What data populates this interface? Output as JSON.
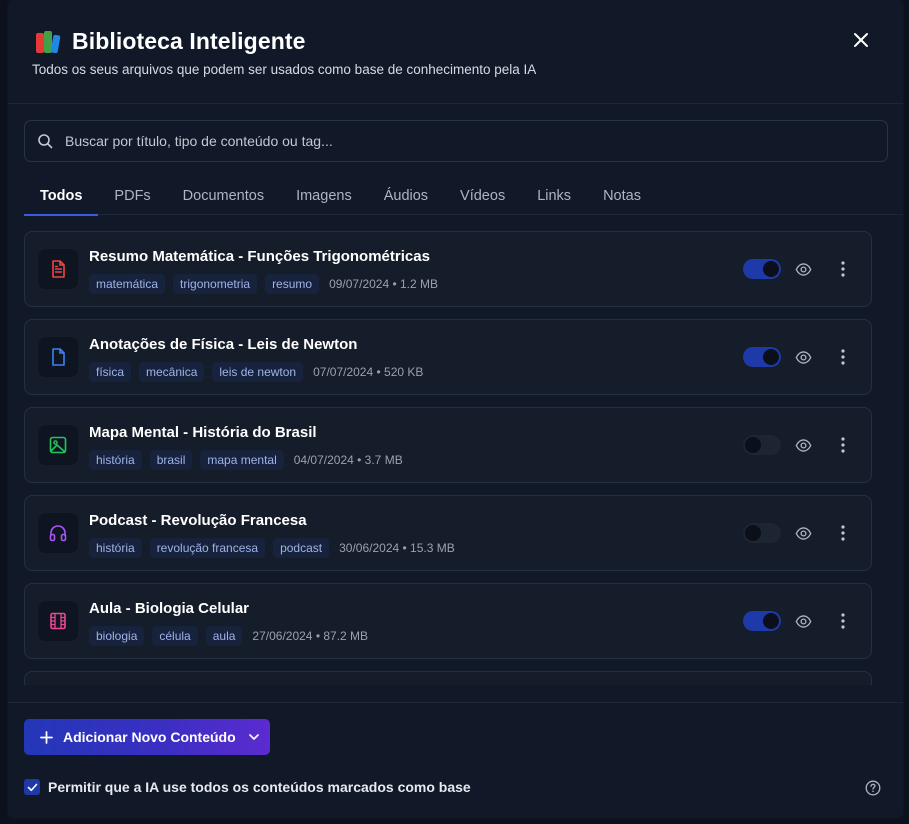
{
  "header": {
    "title": "Biblioteca Inteligente",
    "subtitle": "Todos os seus arquivos que podem ser usados como base de conhecimento pela IA",
    "close_symbol": "✕",
    "outer_close_symbol": "✕",
    "icon": "books-icon"
  },
  "search": {
    "placeholder": "Buscar por título, tipo de conteúdo ou tag...",
    "icon": "search-icon"
  },
  "tabs": [
    {
      "label": "Todos",
      "active": true
    },
    {
      "label": "PDFs",
      "active": false
    },
    {
      "label": "Documentos",
      "active": false
    },
    {
      "label": "Imagens",
      "active": false
    },
    {
      "label": "Áudios",
      "active": false
    },
    {
      "label": "Vídeos",
      "active": false
    },
    {
      "label": "Links",
      "active": false
    },
    {
      "label": "Notas",
      "active": false
    }
  ],
  "items": [
    {
      "title": "Resumo Matemática - Funções Trigonométricas",
      "tags": [
        "matemática",
        "trigonometria",
        "resumo"
      ],
      "meta": "09/07/2024 • 1.2 MB",
      "icon": "pdf-file-icon",
      "icon_color": "#ef4444",
      "enabled": true
    },
    {
      "title": "Anotações de Física - Leis de Newton",
      "tags": [
        "física",
        "mecânica",
        "leis de newton"
      ],
      "meta": "07/07/2024 • 520 KB",
      "icon": "document-icon",
      "icon_color": "#3b82f6",
      "enabled": true
    },
    {
      "title": "Mapa Mental - História do Brasil",
      "tags": [
        "história",
        "brasil",
        "mapa mental"
      ],
      "meta": "04/07/2024 • 3.7 MB",
      "icon": "image-icon",
      "icon_color": "#22c55e",
      "enabled": false
    },
    {
      "title": "Podcast - Revolução Francesa",
      "tags": [
        "história",
        "revolução francesa",
        "podcast"
      ],
      "meta": "30/06/2024 • 15.3 MB",
      "icon": "headphones-icon",
      "icon_color": "#a855f7",
      "enabled": false
    },
    {
      "title": "Aula - Biologia Celular",
      "tags": [
        "biologia",
        "célula",
        "aula"
      ],
      "meta": "27/06/2024 • 87.2 MB",
      "icon": "video-icon",
      "icon_color": "#ec4899",
      "enabled": true
    }
  ],
  "footer": {
    "add_button_label": "Adicionar Novo Conteúdo",
    "add_icon": "plus-icon",
    "dropdown_icon": "chevron-down-icon",
    "allow_ai_label": "Permitir que a IA use todos os conteúdos marcados como base",
    "allow_ai_checked": true,
    "help_icon": "help-icon"
  },
  "colors": {
    "accent": "#1e3aa8",
    "tab_indicator": "#3b5bdb",
    "tag_bg": "#17233d",
    "tag_text": "#9fb2e8"
  }
}
